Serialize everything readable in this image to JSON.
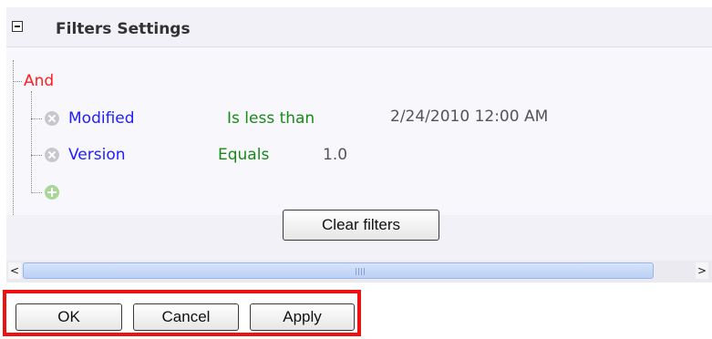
{
  "header": {
    "title": "Filters Settings",
    "toggle_icon": "collapse-minus-icon"
  },
  "tree": {
    "root_operator": "And",
    "conditions": [
      {
        "field": "Modified",
        "operator": "Is less than",
        "value": "2/24/2010 12:00 AM"
      },
      {
        "field": "Version",
        "operator": "Equals",
        "value": "1.0"
      }
    ],
    "add_icon": "add-condition-icon"
  },
  "buttons": {
    "clear_filters": "Clear filters",
    "ok": "OK",
    "cancel": "Cancel",
    "apply": "Apply"
  },
  "scrollbar": {
    "left_arrow": "<",
    "right_arrow": ">"
  },
  "colors": {
    "operator_red": "#ff1e1e",
    "field_blue": "#2020ff",
    "condition_green": "#188a18",
    "highlight_red": "#ee1111",
    "panel_bg": "#f1f1f7"
  }
}
